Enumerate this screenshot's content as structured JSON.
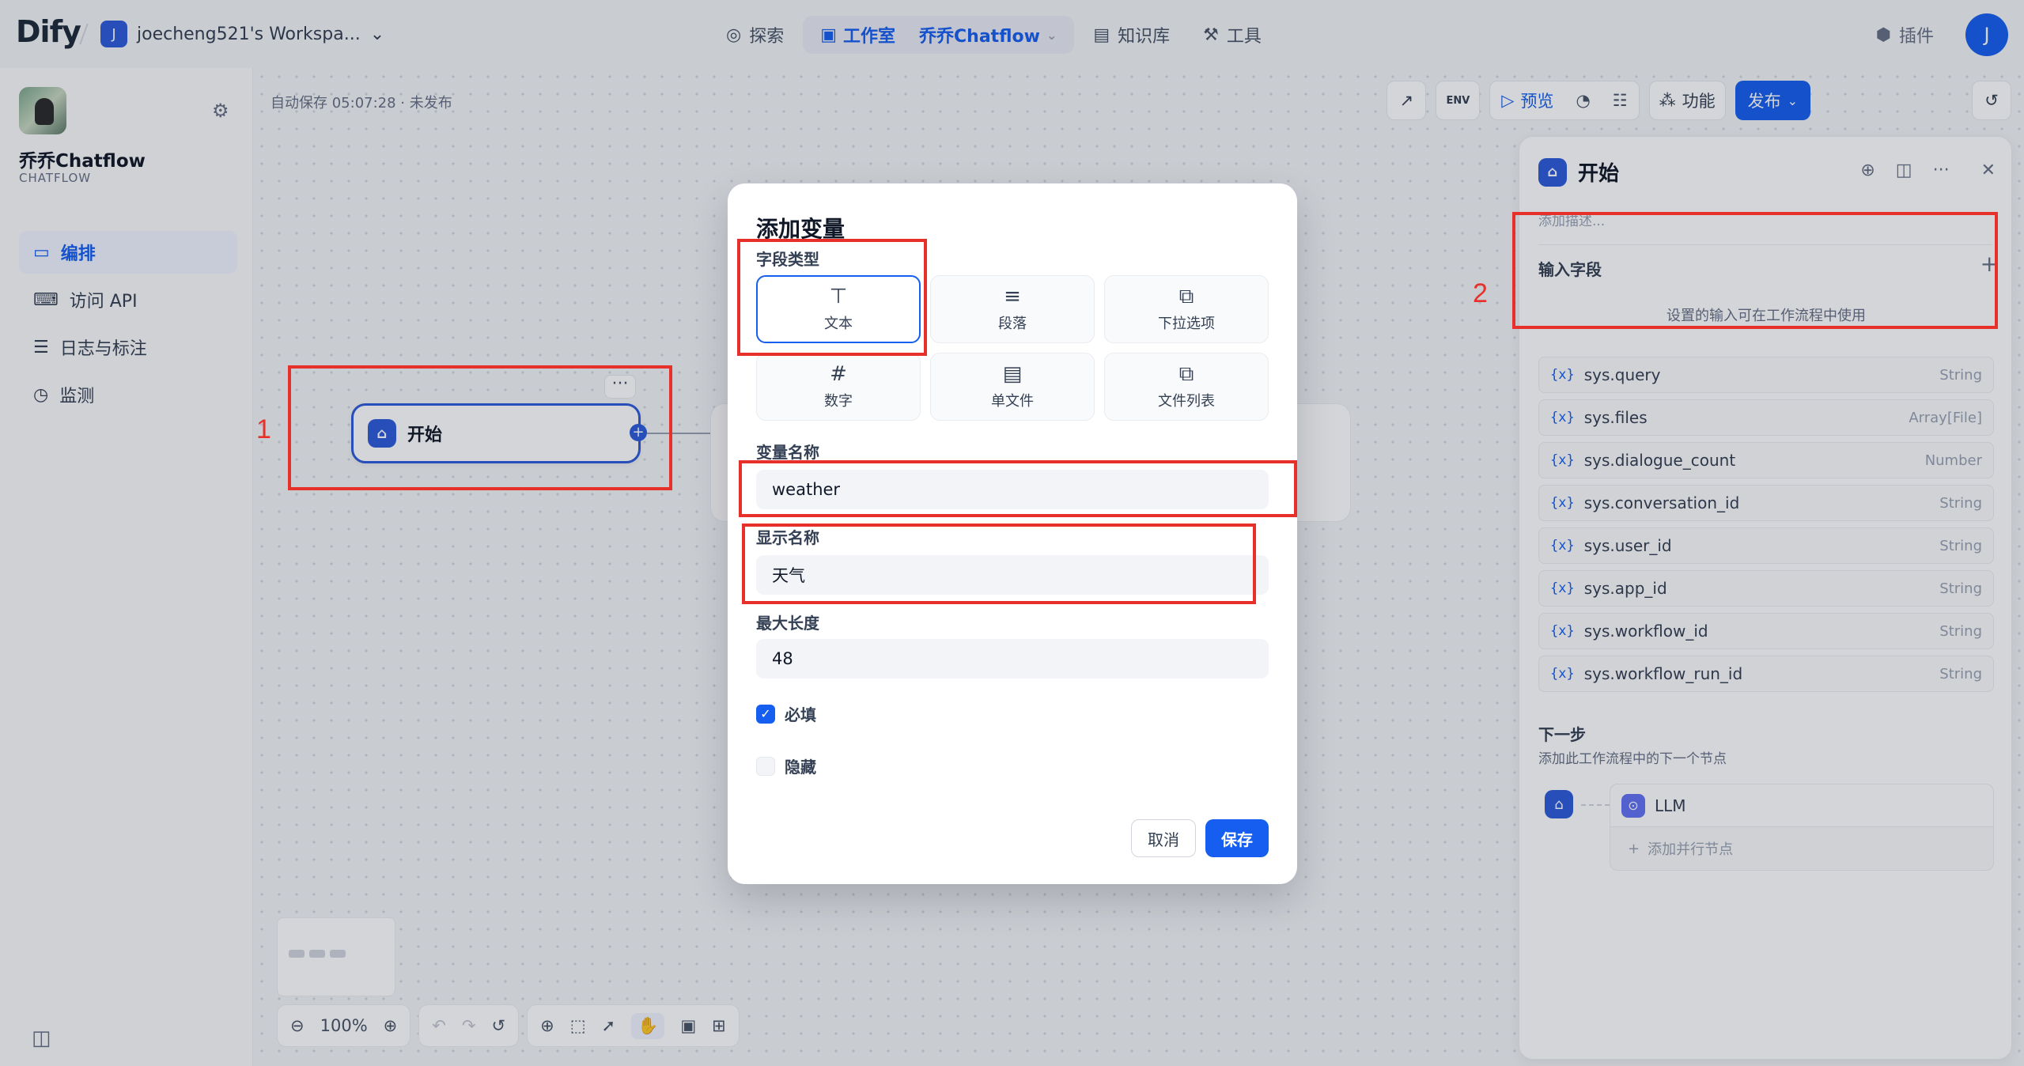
{
  "header": {
    "logo_text": "Dify",
    "workspace_initial": "J",
    "workspace_name": "joecheng521's Workspa...",
    "nav": {
      "explore": "探索",
      "studio": "工作室",
      "app": "乔乔Chatflow",
      "knowledge": "知识库",
      "tools": "工具"
    },
    "plugins": "插件",
    "user_initial": "J"
  },
  "sidebar": {
    "app_name": "乔乔Chatflow",
    "app_type": "CHATFLOW",
    "items": [
      {
        "label": "编排",
        "icon": "layout-icon"
      },
      {
        "label": "访问 API",
        "icon": "terminal-icon"
      },
      {
        "label": "日志与标注",
        "icon": "file-list-icon"
      },
      {
        "label": "监测",
        "icon": "dashboard-icon"
      }
    ]
  },
  "canvas": {
    "autosave": "自动保存 05:07:28 · 未发布",
    "toolbar": {
      "preview": "预览",
      "features": "功能",
      "publish": "发布"
    },
    "start_node_label": "开始",
    "zoom": "100%"
  },
  "right_panel": {
    "title": "开始",
    "desc_placeholder": "添加描述...",
    "section_title": "输入字段",
    "hint": "设置的输入可在工作流程中使用",
    "vars": [
      {
        "name": "sys.query",
        "type": "String"
      },
      {
        "name": "sys.files",
        "type": "Array[File]"
      },
      {
        "name": "sys.dialogue_count",
        "type": "Number"
      },
      {
        "name": "sys.conversation_id",
        "type": "String"
      },
      {
        "name": "sys.user_id",
        "type": "String"
      },
      {
        "name": "sys.app_id",
        "type": "String"
      },
      {
        "name": "sys.workflow_id",
        "type": "String"
      },
      {
        "name": "sys.workflow_run_id",
        "type": "String"
      }
    ],
    "next_title": "下一步",
    "next_desc": "添加此工作流程中的下一个节点",
    "next_node": "LLM",
    "add_parallel": "添加并行节点"
  },
  "modal": {
    "title": "添加变量",
    "field_type_label": "字段类型",
    "types": [
      {
        "label": "文本",
        "icon": "text-icon",
        "selected": true
      },
      {
        "label": "段落",
        "icon": "paragraph-icon",
        "selected": false
      },
      {
        "label": "下拉选项",
        "icon": "select-icon",
        "selected": false
      },
      {
        "label": "数字",
        "icon": "hash-icon",
        "selected": false
      },
      {
        "label": "单文件",
        "icon": "file-icon",
        "selected": false
      },
      {
        "label": "文件列表",
        "icon": "file-list-icon",
        "selected": false
      }
    ],
    "var_name_label": "变量名称",
    "var_name_value": "weather",
    "display_name_label": "显示名称",
    "display_name_value": "天气",
    "max_length_label": "最大长度",
    "max_length_value": "48",
    "required_label": "必填",
    "required_checked": true,
    "hidden_label": "隐藏",
    "hidden_checked": false,
    "cancel": "取消",
    "save": "保存"
  },
  "annotations": {
    "num1": "1",
    "num2": "2"
  },
  "colors": {
    "accent": "#155eef",
    "annotation": "#e8302a"
  }
}
